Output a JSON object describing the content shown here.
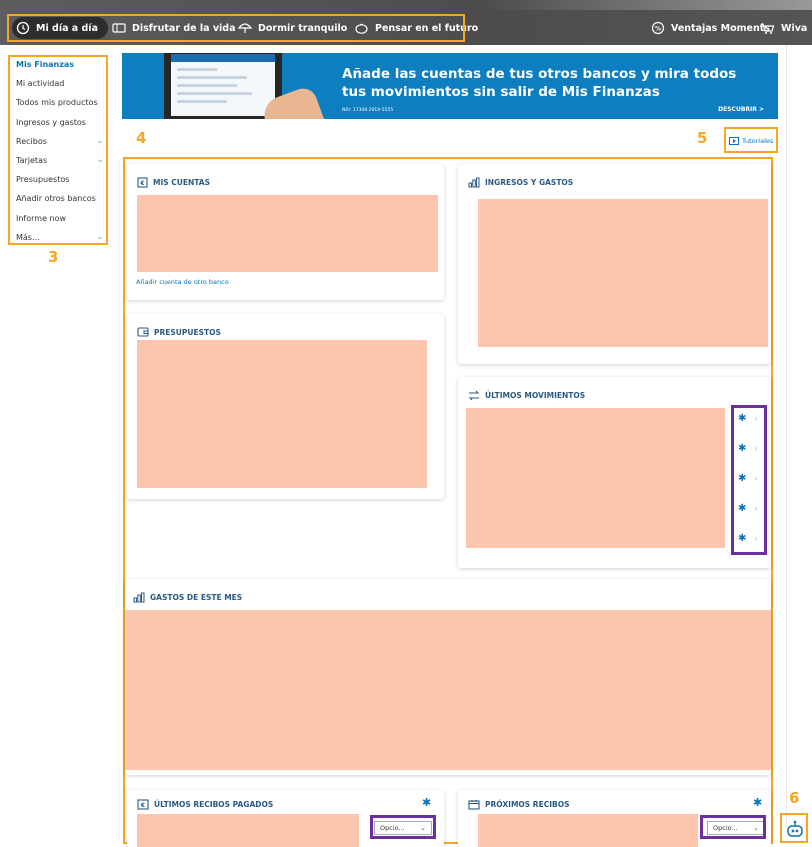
{
  "topnav": {
    "items": [
      {
        "label": "Mi día a día",
        "icon": "clock-icon"
      },
      {
        "label": "Disfrutar de la vida",
        "icon": "ticket-icon"
      },
      {
        "label": "Dormir tranquilo",
        "icon": "umbrella-icon"
      },
      {
        "label": "Pensar en el futuro",
        "icon": "piggy-bank-icon"
      }
    ],
    "right_items": [
      {
        "label": "Ventajas Moments",
        "icon": "percent-badge-icon"
      },
      {
        "label": "Wiva",
        "icon": "cart-icon"
      }
    ]
  },
  "sidebar": {
    "items": [
      {
        "label": "Mis Finanzas",
        "active": true
      },
      {
        "label": "Mi actividad"
      },
      {
        "label": "Todos mis productos"
      },
      {
        "label": "Ingresos y gastos"
      },
      {
        "label": "Recibos",
        "expandable": true
      },
      {
        "label": "Tarjetas",
        "expandable": true
      },
      {
        "label": "Presupuestos"
      },
      {
        "label": "Añadir otros bancos"
      },
      {
        "label": "Informe now"
      },
      {
        "label": "Más...",
        "expandable": true
      }
    ]
  },
  "banner": {
    "title": "Añade las cuentas de tus otros bancos y mira todos tus movimientos sin salir de Mis Finanzas",
    "nri": "NRI: 17308-2019-5555",
    "cta": "DESCUBRIR >"
  },
  "tutorials_label": "Tutoriales",
  "widgets": {
    "mis_cuentas": {
      "title": "MIS CUENTAS",
      "link": "Añadir cuenta de otro banco"
    },
    "ingresos_gastos": {
      "title": "INGRESOS Y GASTOS"
    },
    "presupuestos": {
      "title": "PRESUPUESTOS"
    },
    "ultimos_movimientos": {
      "title": "ÚLTIMOS MOVIMIENTOS",
      "rows": 5
    },
    "gastos_mes": {
      "title": "GASTOS DE ESTE MES"
    },
    "ultimos_recibos": {
      "title": "ÚLTIMOS RECIBOS PAGADOS",
      "select": "Opcio..."
    },
    "proximos_recibos": {
      "title": "PRÓXIMOS RECIBOS",
      "select": "Opcio..."
    }
  },
  "annotations": [
    "3",
    "4",
    "5",
    "6"
  ],
  "colors": {
    "accent": "#0a72b8",
    "annotation": "#f5a623",
    "highlight": "#6b2fa0",
    "placeholder": "#fcc6ae"
  }
}
